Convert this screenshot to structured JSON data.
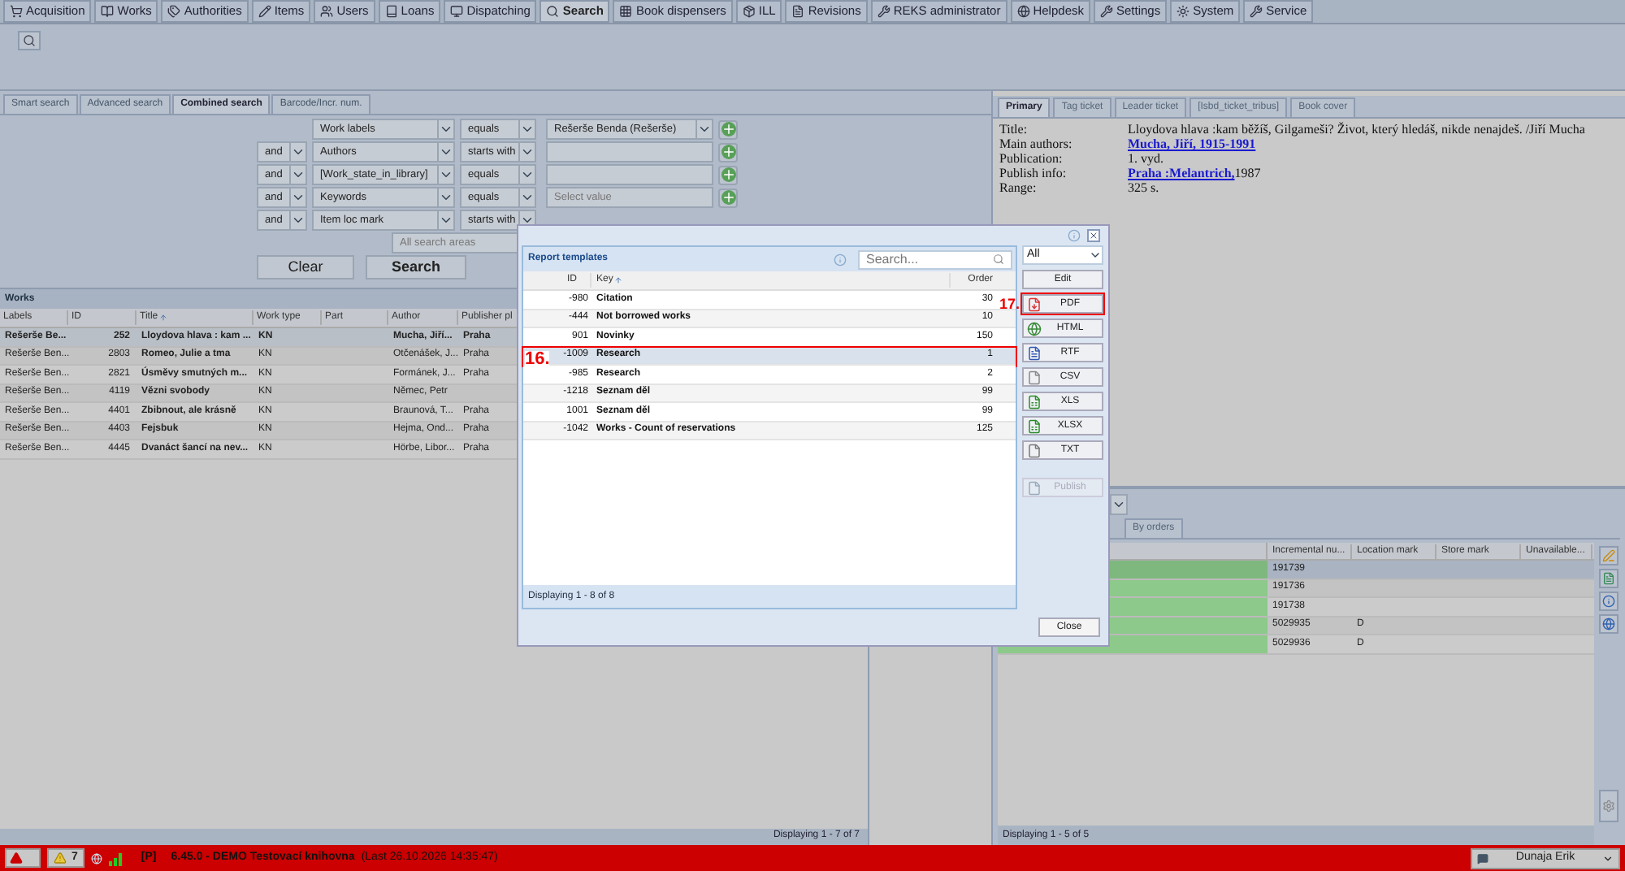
{
  "tabs": [
    {
      "label": "Acquisition",
      "selected": false
    },
    {
      "label": "Works",
      "selected": false
    },
    {
      "label": "Authorities",
      "selected": false
    },
    {
      "label": "Items",
      "selected": false
    },
    {
      "label": "Users",
      "selected": false
    },
    {
      "label": "Loans",
      "selected": false
    },
    {
      "label": "Dispatching",
      "selected": false
    },
    {
      "label": "Search",
      "selected": true
    },
    {
      "label": "Book dispensers",
      "selected": false
    },
    {
      "label": "ILL",
      "selected": false
    },
    {
      "label": "Revisions",
      "selected": false
    },
    {
      "label": "REKS administrator",
      "selected": false
    },
    {
      "label": "Helpdesk",
      "selected": false
    },
    {
      "label": "Settings",
      "selected": false
    },
    {
      "label": "System",
      "selected": false
    },
    {
      "label": "Service",
      "selected": false
    }
  ],
  "search_tabs": [
    {
      "label": "Smart search",
      "selected": false
    },
    {
      "label": "Advanced search",
      "selected": false
    },
    {
      "label": "Combined search",
      "selected": true
    },
    {
      "label": "Barcode/Incr. num.",
      "selected": false
    }
  ],
  "criteria": [
    {
      "field": "Work labels",
      "condition": "equals",
      "value": "Rešerše Benda (Rešerše)",
      "kind": "dropdown"
    },
    {
      "operator": "and",
      "field": "Authors",
      "condition": "starts with",
      "kind": "text"
    },
    {
      "operator": "and",
      "field": "[Work_state_in_library]",
      "condition": "equals",
      "kind": "text"
    },
    {
      "operator": "and",
      "field": "Keywords",
      "condition": "equals",
      "placeholder": "Select value",
      "kind": "text"
    },
    {
      "operator": "and",
      "field": "Item loc mark",
      "condition": "starts with",
      "kind": "hidden"
    }
  ],
  "search_areas": {
    "placeholder": "All search areas"
  },
  "search_buttons": [
    "Clear",
    "Search"
  ],
  "works": {
    "title": "Works",
    "columns": [
      "Labels",
      "ID",
      "Title",
      "Work type",
      "Part",
      "Author",
      "Publisher pl"
    ],
    "rows": [
      {
        "selected": true,
        "cells": [
          "Rešerše Be...",
          "252",
          "Lloydova hlava : kam ...",
          "KN",
          "",
          "Mucha, Jiří...",
          "Praha"
        ]
      },
      {
        "selected": false,
        "cells": [
          "Rešerše Ben...",
          "2803",
          "Romeo, Julie a tma",
          "KN",
          "",
          "Otčenášek, J...",
          "Praha"
        ]
      },
      {
        "selected": false,
        "cells": [
          "Rešerše Ben...",
          "2821",
          "Úsměvy smutných m...",
          "KN",
          "",
          "Formánek, J...",
          "Praha"
        ]
      },
      {
        "selected": false,
        "cells": [
          "Rešerše Ben...",
          "4119",
          "Vězni svobody",
          "KN",
          "",
          "Němec, Petr",
          ""
        ]
      },
      {
        "selected": false,
        "cells": [
          "Rešerše Ben...",
          "4401",
          "Zbibnout, ale krásně",
          "KN",
          "",
          "Braunová, T...",
          "Praha"
        ]
      },
      {
        "selected": false,
        "cells": [
          "Rešerše Ben...",
          "4403",
          "Fejsbuk",
          "KN",
          "",
          "Hejma, Ond...",
          "Praha"
        ]
      },
      {
        "selected": false,
        "cells": [
          "Rešerše Ben...",
          "4445",
          "Dvanáct šancí na nev...",
          "KN",
          "",
          "Hörbe, Libor...",
          "Praha"
        ]
      }
    ],
    "footer": "Displaying 1 - 7 of 7"
  },
  "detail": {
    "tabs": [
      {
        "label": "Primary",
        "selected": true
      },
      {
        "label": "Tag ticket",
        "selected": false
      },
      {
        "label": "Leader ticket",
        "selected": false
      },
      {
        "label": "[Isbd_ticket_tribus]",
        "selected": false
      },
      {
        "label": "Book cover",
        "selected": false
      }
    ],
    "fields": [
      {
        "label": "Title:",
        "text": "Lloydova hlava :kam běžíš, Gilgameši? Život, který hledáš, nikde nenajdeš. /Jiří Mucha"
      },
      {
        "label": "Main authors:",
        "link": "Mucha, Jiří, 1915-1991"
      },
      {
        "label": "Publication:",
        "text": "1. vyd."
      },
      {
        "label": "Publish info:",
        "link": "Praha :Melantrich,",
        "text": "1987"
      },
      {
        "label": "Range:",
        "text": "325 s."
      }
    ]
  },
  "items": {
    "tabs": [
      {
        "label": "By orders",
        "selected": false
      }
    ],
    "columns": [
      "Incremental nu...",
      "Location mark",
      "Store mark",
      "Unavailable..."
    ],
    "rows": [
      {
        "selected": true,
        "cells": [
          "191739",
          "",
          "",
          ""
        ]
      },
      {
        "selected": false,
        "cells": [
          "191736",
          "",
          "",
          ""
        ]
      },
      {
        "selected": false,
        "cells": [
          "191738",
          "",
          "",
          ""
        ]
      },
      {
        "selected": false,
        "cells": [
          "5029935",
          "D",
          "",
          ""
        ]
      },
      {
        "selected": false,
        "cells": [
          "5029936",
          "D",
          "",
          ""
        ]
      }
    ],
    "footer": "Displaying 1 - 5 of 5"
  },
  "dialog": {
    "title": "Report templates",
    "search": {
      "placeholder": "Search..."
    },
    "columns": [
      "ID",
      "Key",
      "Order"
    ],
    "rows": [
      {
        "id": "-980",
        "key": "Citation",
        "order": "30",
        "selected": false
      },
      {
        "id": "-444",
        "key": "Not borrowed works",
        "order": "10",
        "selected": false
      },
      {
        "id": "901",
        "key": "Novinky",
        "order": "150",
        "selected": false
      },
      {
        "id": "-1009",
        "key": "Research",
        "order": "1",
        "selected": true,
        "marker": "16."
      },
      {
        "id": "-985",
        "key": "Research",
        "order": "2",
        "selected": false
      },
      {
        "id": "-1218",
        "key": "Seznam děl",
        "order": "99",
        "selected": false
      },
      {
        "id": "1001",
        "key": "Seznam děl",
        "order": "99",
        "selected": false
      },
      {
        "id": "-1042",
        "key": "Works - Count of reservations",
        "order": "125",
        "selected": false
      }
    ],
    "footer": "Displaying 1 - 8 of 8",
    "filter": "All",
    "actions": [
      {
        "label": "Edit",
        "kind": "plain",
        "disabled": false
      },
      {
        "label": "PDF",
        "kind": "pdf",
        "disabled": false,
        "marker": "17."
      },
      {
        "label": "HTML",
        "kind": "html",
        "disabled": false
      },
      {
        "label": "RTF",
        "kind": "rtf",
        "disabled": false
      },
      {
        "label": "CSV",
        "kind": "csv",
        "disabled": false
      },
      {
        "label": "XLS",
        "kind": "xls",
        "disabled": false
      },
      {
        "label": "XLSX",
        "kind": "xlsx",
        "disabled": false
      },
      {
        "label": "TXT",
        "kind": "txt",
        "disabled": false
      },
      {
        "label": "Publish",
        "kind": "publish",
        "disabled": true
      }
    ],
    "close": "Close"
  },
  "status_bar": {
    "warnings": "7",
    "mode": "[P]",
    "version": "6.45.0 - DEMO Testovací knihovna",
    "last": "(Last 26.10.2026 14:35:47)",
    "user": "Dunaja Erik"
  }
}
